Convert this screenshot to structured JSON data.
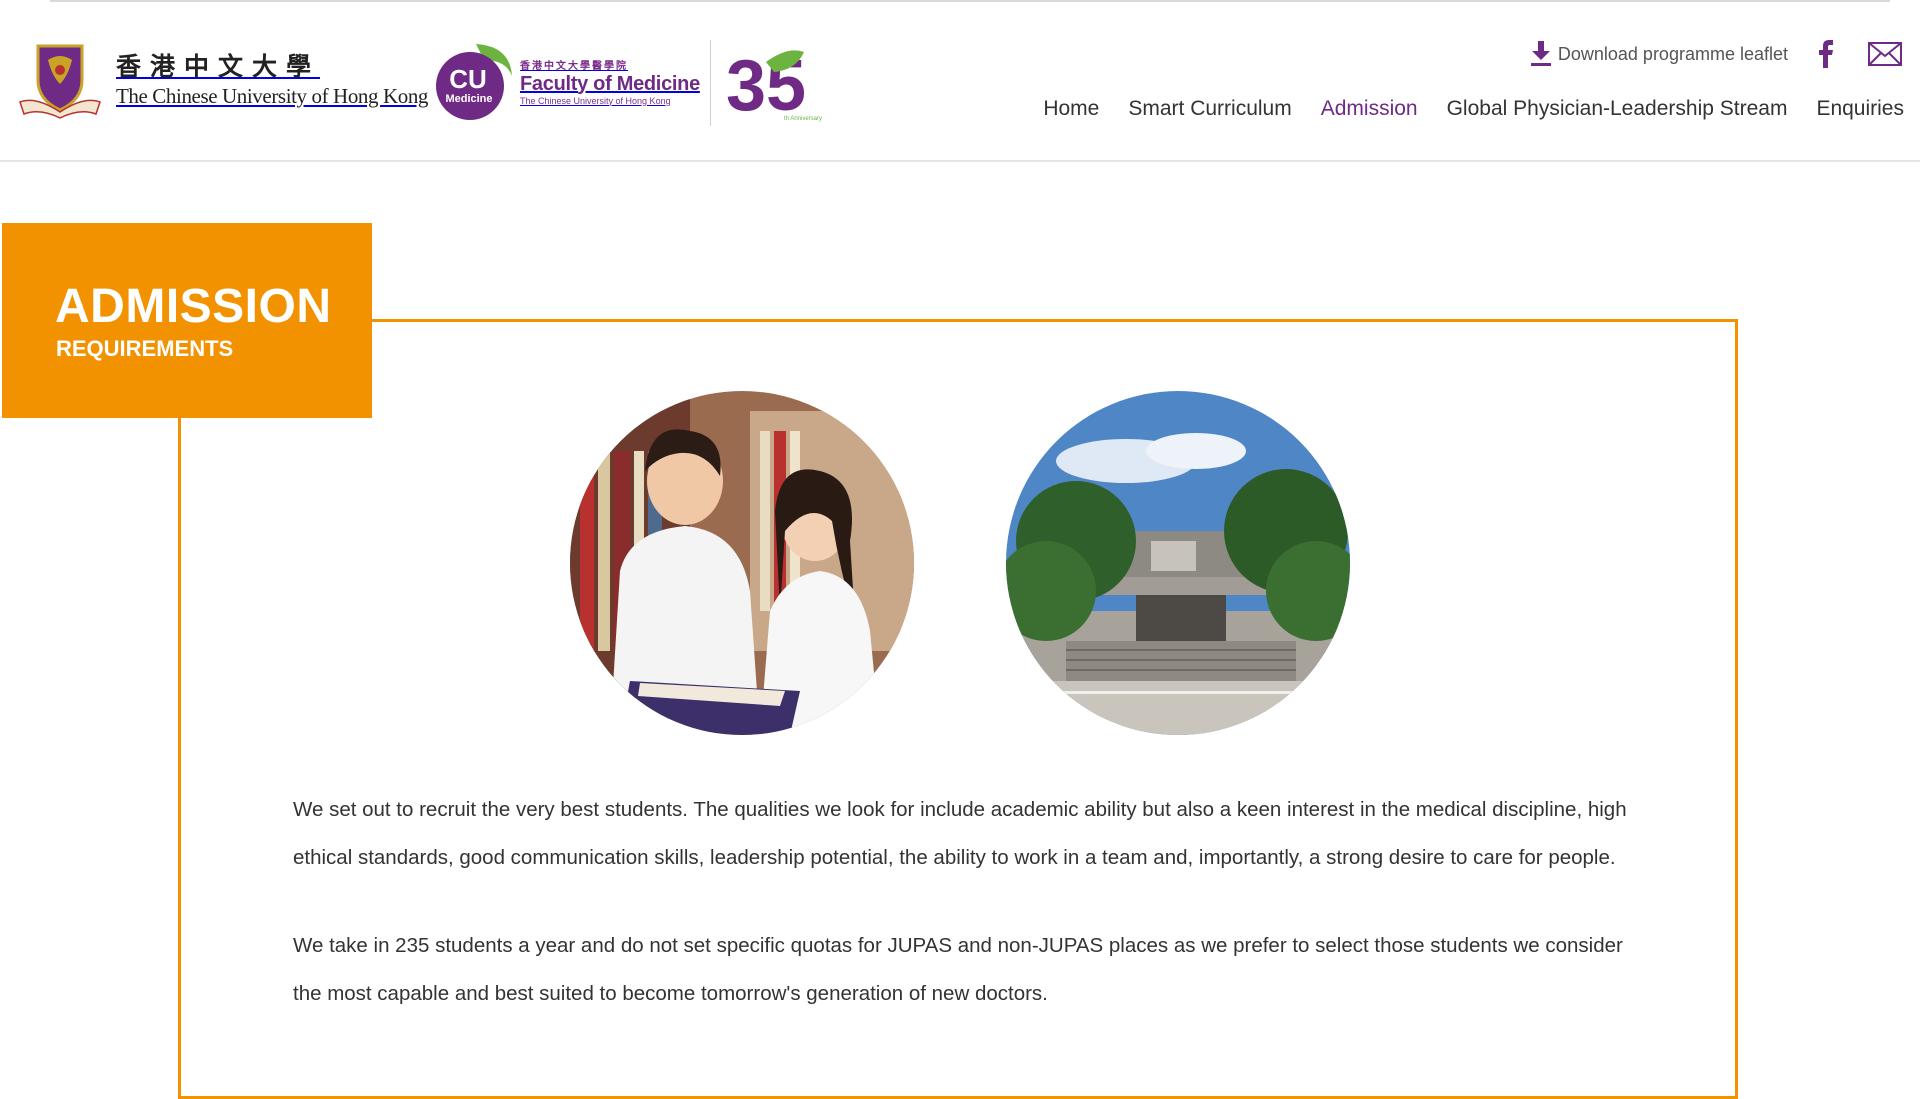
{
  "header": {
    "cuhk_logo": {
      "name_zh": "香港中文大學",
      "name_en": "The Chinese University of Hong Kong"
    },
    "faculty_logo": {
      "badge_main": "CU",
      "badge_sub": "Medicine",
      "name_zh": "香港中文大學醫學院",
      "name_en": "Faculty of Medicine",
      "name_sub": "The Chinese University of Hong Kong"
    },
    "anniversary_logo": {
      "number": "35",
      "caption": "th Anniversary"
    },
    "download_label": "Download programme leaflet",
    "nav": [
      {
        "label": "Home",
        "active": false
      },
      {
        "label": "Smart Curriculum",
        "active": false
      },
      {
        "label": "Admission",
        "active": true
      },
      {
        "label": "Global Physician-Leadership Stream",
        "active": false
      },
      {
        "label": "Enquiries",
        "active": false
      }
    ]
  },
  "section": {
    "title": "ADMISSION",
    "subtitle": "REQUIREMENTS",
    "paragraphs": [
      "We set out to recruit the very best students. The qualities we look for include academic ability but also a keen interest in the medical discipline, high ethical standards, good communication skills, leadership potential, the ability to work in a team and, importantly, a strong desire to care for people.",
      "We take in 235 students a year and do not set specific quotas for JUPAS and non-JUPAS places as we prefer to select those students we consider the most capable and best suited to become tomorrow's generation of new doctors."
    ]
  },
  "colors": {
    "accent_orange": "#f39200",
    "brand_purple": "#6f2a85",
    "brand_green": "#6db33f"
  },
  "icons": {
    "download": "download-icon",
    "facebook": "facebook-icon",
    "mail": "mail-icon"
  }
}
